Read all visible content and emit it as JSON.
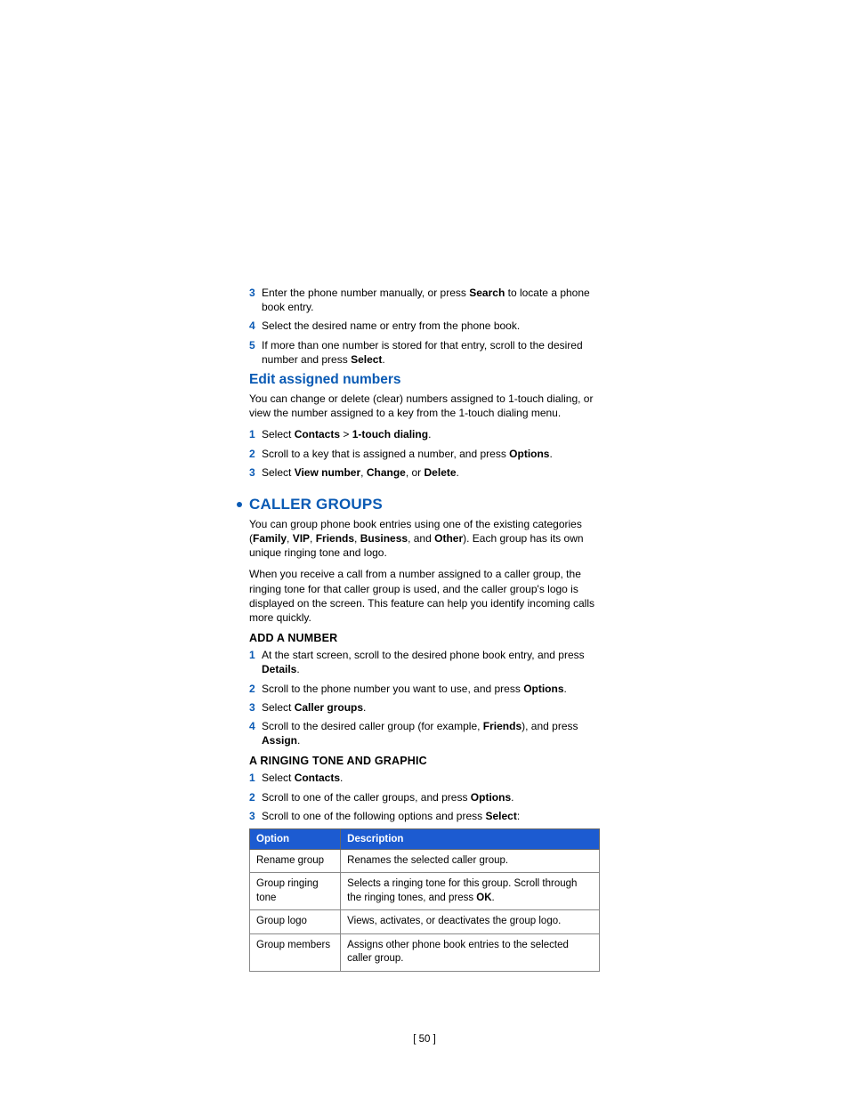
{
  "steps_top": [
    {
      "n": "3",
      "parts": [
        "Enter the phone number manually, or press ",
        {
          "b": "Search"
        },
        " to locate a phone book entry."
      ]
    },
    {
      "n": "4",
      "parts": [
        "Select the desired name or entry from the phone book."
      ]
    },
    {
      "n": "5",
      "parts": [
        "If more than one number is stored for that entry, scroll to the desired number and press ",
        {
          "b": "Select"
        },
        "."
      ]
    }
  ],
  "edit_heading": "Edit assigned numbers",
  "edit_para": "You can change or delete (clear) numbers assigned to 1-touch dialing, or view the number assigned to a key from the 1-touch dialing menu.",
  "edit_steps": [
    {
      "n": "1",
      "parts": [
        "Select ",
        {
          "b": "Contacts"
        },
        " > ",
        {
          "b": "1-touch dialing"
        },
        "."
      ]
    },
    {
      "n": "2",
      "parts": [
        "Scroll to a key that is assigned a number, and press ",
        {
          "b": "Options"
        },
        "."
      ]
    },
    {
      "n": "3",
      "parts": [
        "Select ",
        {
          "b": "View number"
        },
        ", ",
        {
          "b": "Change"
        },
        ", or ",
        {
          "b": "Delete"
        },
        "."
      ]
    }
  ],
  "caller_heading": "CALLER GROUPS",
  "caller_para1_parts": [
    "You can group phone book entries using one of the existing categories (",
    {
      "b": "Family"
    },
    ", ",
    {
      "b": "VIP"
    },
    ", ",
    {
      "b": "Friends"
    },
    ", ",
    {
      "b": "Business"
    },
    ", and ",
    {
      "b": "Other"
    },
    "). Each group has its own unique ringing tone and logo."
  ],
  "caller_para2": "When you receive a call from a number assigned to a caller group, the ringing tone for that caller group is used, and the caller group's logo is displayed on the screen. This feature can help you identify incoming calls more quickly.",
  "add_heading": "ADD A NUMBER",
  "add_steps": [
    {
      "n": "1",
      "parts": [
        "At the start screen, scroll to the desired phone book entry, and press ",
        {
          "b": "Details"
        },
        "."
      ]
    },
    {
      "n": "2",
      "parts": [
        "Scroll to the phone number you want to use, and press ",
        {
          "b": "Options"
        },
        "."
      ]
    },
    {
      "n": "3",
      "parts": [
        "Select ",
        {
          "b": "Caller groups"
        },
        "."
      ]
    },
    {
      "n": "4",
      "parts": [
        "Scroll to the desired caller group (for example, ",
        {
          "b": "Friends"
        },
        "), and press ",
        {
          "b": "Assign"
        },
        "."
      ]
    }
  ],
  "ring_heading": "A RINGING TONE AND GRAPHIC",
  "ring_steps": [
    {
      "n": "1",
      "parts": [
        "Select ",
        {
          "b": "Contacts"
        },
        "."
      ]
    },
    {
      "n": "2",
      "parts": [
        "Scroll to one of the caller groups, and press ",
        {
          "b": "Options"
        },
        "."
      ]
    },
    {
      "n": "3",
      "parts": [
        "Scroll to one of the following options and press ",
        {
          "b": "Select"
        },
        ":"
      ]
    }
  ],
  "table": {
    "headers": [
      "Option",
      "Description"
    ],
    "rows": [
      {
        "opt": "Rename group",
        "desc_parts": [
          "Renames the selected caller group."
        ]
      },
      {
        "opt": "Group ringing tone",
        "desc_parts": [
          "Selects a ringing tone for this group. Scroll through the ringing tones, and press ",
          {
            "b": "OK"
          },
          "."
        ]
      },
      {
        "opt": "Group logo",
        "desc_parts": [
          "Views, activates, or deactivates the group logo."
        ]
      },
      {
        "opt": "Group members",
        "desc_parts": [
          "Assigns other phone book entries to the selected caller group."
        ]
      }
    ]
  },
  "page_number": "[ 50 ]"
}
